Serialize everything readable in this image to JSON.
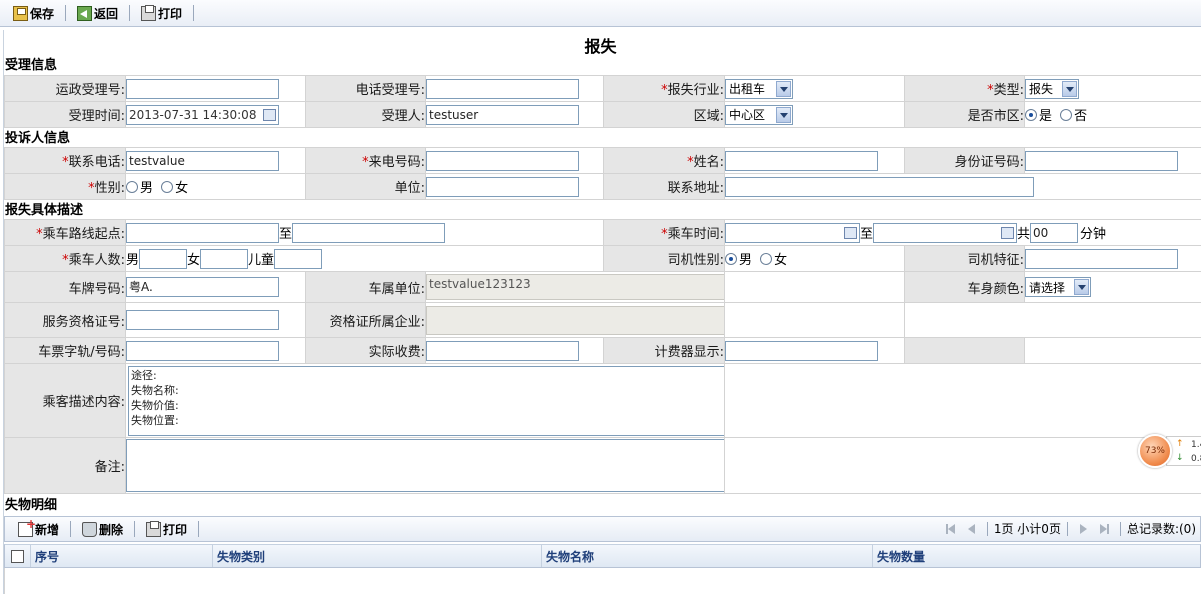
{
  "toolbar": {
    "save": "保存",
    "back": "返回",
    "print": "打印"
  },
  "page_title": "报失",
  "sections": {
    "accept": "受理信息",
    "complainant": "投诉人信息",
    "description": "报失具体描述",
    "lost_items": "失物明细"
  },
  "accept": {
    "transport_no_label": "运政受理号:",
    "phone_no_label": "电话受理号:",
    "industry_label": "报失行业:",
    "industry_value": "出租车",
    "type_label": "类型:",
    "type_value": "报失",
    "time_label": "受理时间:",
    "time_value": "2013-07-31 14:30:08",
    "acceptor_label": "受理人:",
    "acceptor_value": "testuser",
    "region_label": "区域:",
    "region_value": "中心区",
    "city_label": "是否市区:",
    "yes": "是",
    "no": "否"
  },
  "complainant": {
    "contact_phone_label": "联系电话:",
    "contact_phone_value": "testvalue",
    "caller_no_label": "来电号码:",
    "name_label": "姓名:",
    "id_label": "身份证号码:",
    "gender_label": "性别:",
    "male": "男",
    "female": "女",
    "unit_label": "单位:",
    "address_label": "联系地址:"
  },
  "description": {
    "route_start_label": "乘车路线起点:",
    "to": "至",
    "ride_time_label": "乘车时间:",
    "total": "共",
    "minutes_value": "00",
    "minutes_unit": "分钟",
    "passengers_label": "乘车人数:",
    "male": "男",
    "female": "女",
    "child": "儿童",
    "driver_gender_label": "司机性别:",
    "driver_feature_label": "司机特征:",
    "plate_label": "车牌号码:",
    "plate_value": "粤A.",
    "vehicle_unit_label": "车属单位:",
    "vehicle_unit_value": "testvalue123123",
    "color_label": "车身颜色:",
    "color_value": "请选择",
    "license_label": "服务资格证号:",
    "license_company_label": "资格证所属企业:",
    "ticket_label": "车票字轨/号码:",
    "fare_label": "实际收费:",
    "meter_label": "计费器显示:",
    "passenger_desc_label": "乘客描述内容:",
    "passenger_desc_lines": [
      "途径:",
      "失物名称:",
      "失物价值:",
      "失物位置:"
    ],
    "remark_label": "备注:"
  },
  "grid": {
    "add": "新增",
    "delete": "删除",
    "print": "打印",
    "page_info": "1页 小计0页",
    "total_records": "总记录数:(0)",
    "columns": [
      "序号",
      "失物类别",
      "失物名称",
      "失物数量"
    ]
  },
  "widget": {
    "percent": "73%",
    "up_value": "1.4",
    "down_value": "0.8"
  }
}
